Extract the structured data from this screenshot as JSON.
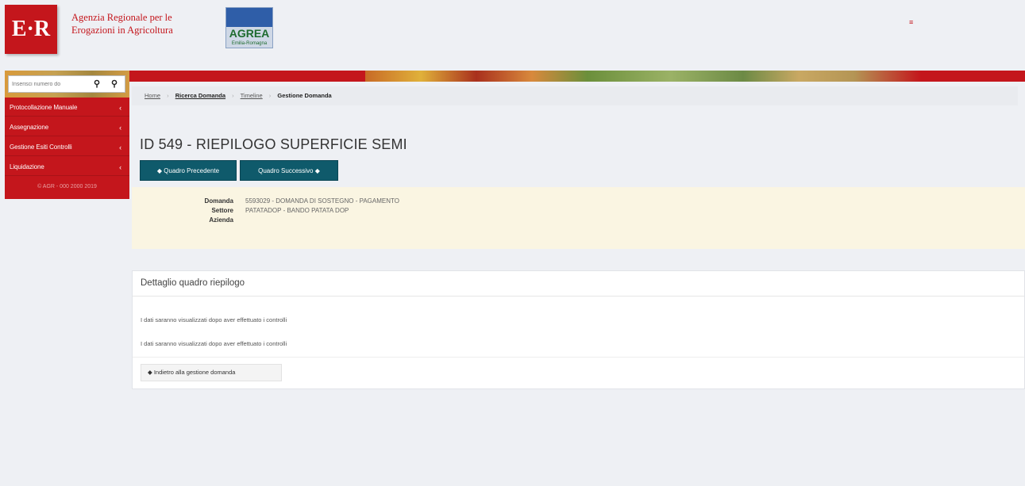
{
  "header": {
    "logo_text": "E·R",
    "agency_line1": "Agenzia Regionale per le",
    "agency_line2": "Erogazioni in Agricoltura",
    "agrea_text": "AGREA",
    "agrea_sub": "Emilia-Romagna",
    "menu_icon": "≡"
  },
  "sidebar": {
    "search_placeholder": "Inserisci numero do",
    "items": [
      {
        "label": "Protocollazione Manuale",
        "icon": "chevron-left-icon"
      },
      {
        "label": "Assegnazione",
        "icon": "chevron-left-icon"
      },
      {
        "label": "Gestione Esiti Controlli",
        "icon": "chevron-left-icon"
      },
      {
        "label": "Liquidazione",
        "icon": "chevron-left-icon"
      }
    ],
    "footer": "© AGR - 000 2000 2019"
  },
  "breadcrumb": {
    "items": [
      "Home",
      "Ricerca Domanda",
      "Timeline",
      "Gestione Domanda"
    ]
  },
  "page": {
    "title": "ID 549 - RIEPILOGO SUPERFICIE SEMI",
    "prev_button": "◆ Quadro Precedente",
    "next_button": "Quadro Successivo ◆"
  },
  "info": {
    "domanda_label": "Domanda",
    "domanda_value": "5593029 - DOMANDA DI SOSTEGNO - PAGAMENTO",
    "settore_label": "Settore",
    "settore_value": "PATATADOP - BANDO PATATA DOP",
    "azienda_label": "Azienda",
    "azienda_value": ""
  },
  "detail": {
    "header": "Dettaglio quadro riepilogo",
    "text1": "I dati saranno visualizzati dopo aver effettuato i controlli",
    "text2": "I dati saranno visualizzati dopo aver effettuato i controlli",
    "back_button": "◆ Indietro alla gestione domanda"
  },
  "colors": {
    "brand_red": "#c4161c",
    "button_teal": "#0f5a6b",
    "info_bg": "#faf5e2"
  }
}
